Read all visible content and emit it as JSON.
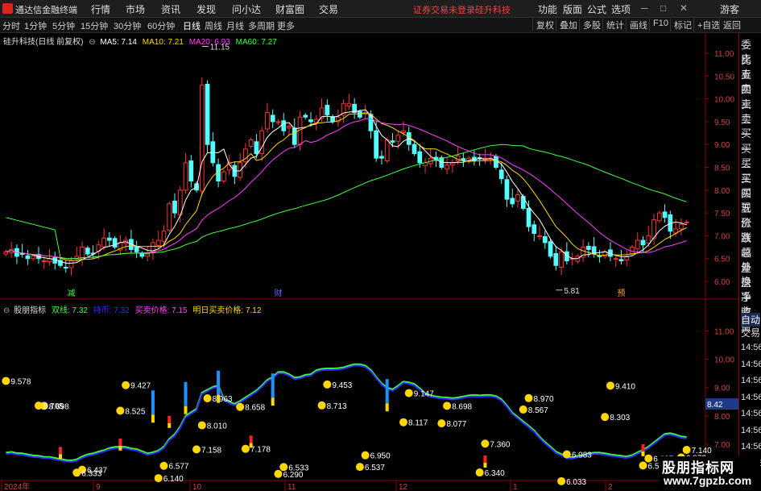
{
  "app": {
    "title": "通达信金融终端",
    "menus": [
      "行情",
      "市场",
      "资讯",
      "发现",
      "问小达",
      "财富圈",
      "交易"
    ],
    "notice": "证券交易未登录",
    "stock_name": "硅升科技",
    "right_menus": [
      "功能",
      "版面",
      "公式",
      "选项"
    ],
    "guest": "游客"
  },
  "toolbar": {
    "periods": [
      "分时",
      "1分钟",
      "5分钟",
      "15分钟",
      "30分钟",
      "60分钟",
      "日线",
      "周线",
      "月线",
      "多周期",
      "更多"
    ],
    "active_period": "日线",
    "buttons": [
      "复权",
      "叠加",
      "多股",
      "统计",
      "画线",
      "F10",
      "标记",
      "+自选",
      "返回"
    ]
  },
  "main_chart": {
    "title": "硅升科技(日线 前复权)",
    "ma_labels": [
      {
        "text": "MA5: 7.14",
        "color": "#ffffff"
      },
      {
        "text": "MA10: 7.21",
        "color": "#ffd700"
      },
      {
        "text": "MA20: 6.93",
        "color": "#ff40ff"
      },
      {
        "text": "MA60: 7.27",
        "color": "#40ff40"
      }
    ],
    "high_label": "11.15",
    "low_label": "5.81",
    "markers": [
      "减",
      "财",
      "预"
    ],
    "y_ticks": [
      "11.00",
      "10.50",
      "10.00",
      "9.50",
      "9.00",
      "8.50",
      "8.00",
      "7.50",
      "7.00",
      "6.50",
      "6.00"
    ]
  },
  "sub_chart": {
    "title": "股朋指标",
    "legend": [
      {
        "text": "双线: 7.32",
        "color": "#40ff40"
      },
      {
        "text": "持币: 7.32",
        "color": "#3030ff"
      },
      {
        "text": "买卖价格: 7.15",
        "color": "#ff40ff"
      },
      {
        "text": "明日买卖价格: 7.12",
        "color": "#ffd700"
      }
    ],
    "y_ticks": [
      "11.00",
      "10.00",
      "9.00",
      "8.00",
      "7.00"
    ],
    "price_tag": "8.42",
    "annotations": [
      "9.578",
      "8.963",
      "9.147",
      "9.410",
      "9.427",
      "9.453",
      "8.970",
      "8.698",
      "7.178",
      "8.698",
      "6.837",
      "6.577",
      "6.950",
      "6.983",
      "6.437",
      "6.533",
      "7.360",
      "7.140",
      "8.010",
      "8.117",
      "8.303",
      "8.525",
      "8.713",
      "8.567",
      "8.705",
      "8.658",
      "8.077",
      "6.587",
      "6.140",
      "6.537",
      "6.033",
      "6.333",
      "6.290",
      "6.340",
      "6.873",
      "7.158"
    ]
  },
  "x_axis": [
    "2024年",
    "9",
    "10",
    "11",
    "12",
    "1",
    "2"
  ],
  "right_panel": {
    "items": [
      "委比",
      "卖五",
      "卖四",
      "卖三",
      "卖二",
      "卖一",
      "买一",
      "买二",
      "买三",
      "买四",
      "买五",
      "现价",
      "涨跌",
      "涨幅",
      "总量",
      "外盘",
      "换手",
      "净资",
      "收益"
    ],
    "tabs": [
      "自动",
      "交易"
    ],
    "times": [
      "14:56",
      "14:56",
      "14:56",
      "14:56",
      "14:56",
      "14:56",
      "14:56",
      "14:56"
    ]
  },
  "watermark": {
    "line1": "股朋指标网",
    "line2": "www.7gpzb.com"
  },
  "chart_data": {
    "type": "candlestick",
    "title": "硅升科技(日线 前复权)",
    "ylim": [
      5.7,
      11.3
    ],
    "close": [
      6.65,
      6.7,
      6.55,
      6.6,
      6.5,
      6.55,
      6.5,
      6.45,
      6.5,
      6.4,
      6.35,
      6.3,
      6.45,
      6.55,
      6.75,
      6.6,
      6.6,
      6.8,
      6.95,
      6.9,
      6.75,
      6.85,
      6.9,
      6.7,
      6.65,
      6.55,
      6.6,
      6.85,
      6.9,
      7.1,
      7.7,
      7.5,
      8.0,
      8.6,
      8.2,
      8.0,
      10.3,
      9.0,
      8.6,
      8.2,
      8.4,
      8.6,
      8.3,
      8.6,
      8.9,
      9.1,
      8.8,
      9.3,
      9.7,
      9.5,
      9.5,
      9.3,
      9.4,
      9.0,
      9.6,
      9.6,
      9.5,
      9.55,
      9.8,
      9.65,
      9.5,
      9.6,
      9.9,
      9.9,
      9.7,
      9.6,
      9.7,
      9.3,
      8.7,
      8.7,
      9.1,
      9.05,
      9.2,
      9.3,
      9.0,
      8.8,
      8.6,
      8.6,
      8.7,
      8.65,
      8.5,
      8.55,
      8.6,
      8.75,
      8.65,
      8.7,
      8.65,
      8.7,
      8.7,
      8.7,
      8.5,
      8.25,
      7.8,
      7.7,
      7.9,
      7.6,
      7.2,
      7.05,
      7.0,
      6.85,
      6.55,
      6.35,
      6.65,
      6.45,
      6.5,
      6.55,
      6.75,
      6.7,
      6.6,
      6.55,
      6.65,
      6.55,
      6.5,
      6.45,
      6.55,
      6.75,
      6.9,
      6.8,
      7.0,
      7.35,
      7.5,
      7.4,
      7.1,
      7.15,
      7.25,
      7.3
    ],
    "ma_lines": [
      {
        "name": "MA5",
        "color": "#ffffff",
        "last": 7.14
      },
      {
        "name": "MA10",
        "color": "#ffd700",
        "last": 7.21
      },
      {
        "name": "MA20",
        "color": "#ff40ff",
        "last": 6.93
      },
      {
        "name": "MA60",
        "color": "#40ff40",
        "last": 7.27
      }
    ],
    "indicator": {
      "title": "股朋指标",
      "ylim": [
        5.8,
        11.7
      ],
      "series": [
        {
          "name": "双线",
          "color": "#40ff40",
          "last": 7.32
        },
        {
          "name": "持币",
          "color": "#3030ff",
          "last": 7.32
        }
      ]
    }
  }
}
